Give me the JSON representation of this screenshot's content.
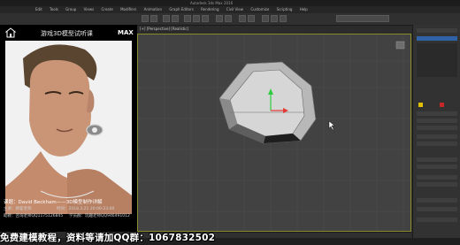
{
  "window": {
    "title": "Autodesk 3ds Max 2016"
  },
  "menu": {
    "items": [
      "Edit",
      "Tools",
      "Group",
      "Views",
      "Create",
      "Modifiers",
      "Animation",
      "Graph Editors",
      "Rendering",
      "Civil View",
      "Customize",
      "Scripting",
      "Help"
    ]
  },
  "viewport": {
    "label": "[+] [Perspective] [Realistic]"
  },
  "overlay": {
    "title": "游戏3D模型试听课",
    "brand": "MAX",
    "course_line": "课题：David Beckham——3D模型制作详解",
    "teacher_label": "主讲：顾茗老师",
    "time_label": "时间：2018.3.21 20:00-23:00",
    "contact_line": "助教：咨询老师QQ1175126845",
    "contact_line2": "学员群：玩趣老师QQ946491012"
  },
  "promo": {
    "text": "免费建模教程，资料等请加QQ群：1067832502"
  },
  "colors": {
    "viewport_bg": "#424242",
    "overlay_bg": "#000000",
    "active_border": "#8a8a2a",
    "accent_blue": "#2f62a6"
  }
}
